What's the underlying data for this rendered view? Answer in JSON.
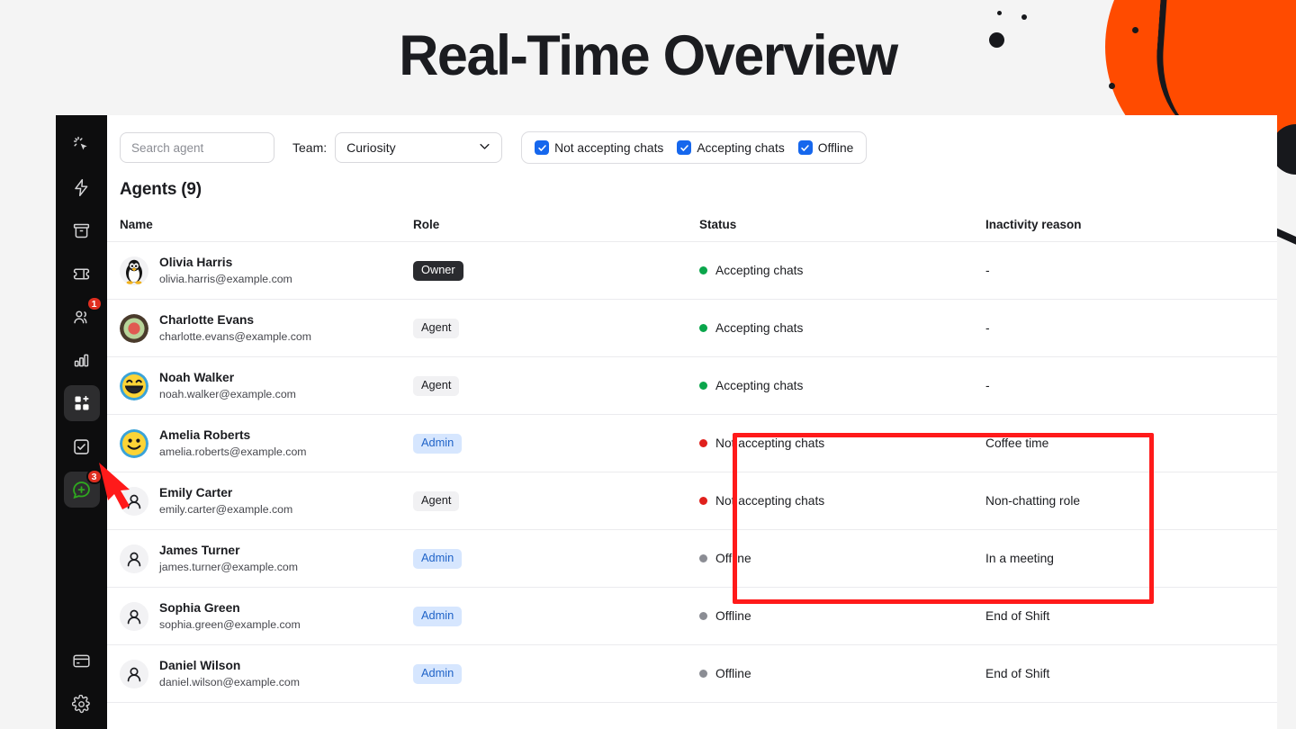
{
  "page": {
    "title": "Real-Time Overview",
    "background_color": "#f4f4f4",
    "accent_orange": "#ff4b00",
    "highlight_color": "#ff1a1a"
  },
  "sidebar": {
    "items": [
      {
        "name": "automation-cursor-icon",
        "icon": "cursor-sparkle",
        "badge": null,
        "active": false
      },
      {
        "name": "quick-actions-icon",
        "icon": "lightning-bolt",
        "badge": null,
        "active": false
      },
      {
        "name": "archives-icon",
        "icon": "archive-box",
        "badge": null,
        "active": false
      },
      {
        "name": "tickets-icon",
        "icon": "ticket",
        "badge": null,
        "active": false
      },
      {
        "name": "team-icon",
        "icon": "people",
        "badge": "1",
        "active": false
      },
      {
        "name": "reports-icon",
        "icon": "bar-chart",
        "badge": null,
        "active": false
      },
      {
        "name": "apps-icon",
        "icon": "grid-plus",
        "badge": null,
        "active": true
      },
      {
        "name": "tasks-icon",
        "icon": "checkbox-task",
        "badge": null,
        "active": false
      },
      {
        "name": "chats-icon",
        "icon": "chat-plus",
        "badge": "3",
        "active": true
      }
    ],
    "bottom_items": [
      {
        "name": "billing-icon",
        "icon": "credit-card"
      },
      {
        "name": "settings-icon",
        "icon": "gear"
      }
    ]
  },
  "toolbar": {
    "search_placeholder": "Search agent",
    "search_value": "",
    "team_label": "Team:",
    "team_selected": "Curiosity",
    "filters": [
      {
        "label": "Not accepting chats",
        "checked": true
      },
      {
        "label": "Accepting chats",
        "checked": true
      },
      {
        "label": "Offline",
        "checked": true
      }
    ]
  },
  "main": {
    "section_title": "Agents (9)",
    "columns": [
      "Name",
      "Role",
      "Status",
      "Inactivity reason"
    ],
    "rows": [
      {
        "name": "Olivia Harris",
        "email": "olivia.harris@example.com",
        "avatar": "penguin",
        "role": "Owner",
        "role_style": "owner",
        "status": "Accepting chats",
        "status_color": "#0aa64b",
        "reason": "-"
      },
      {
        "name": "Charlotte Evans",
        "email": "charlotte.evans@example.com",
        "avatar": "bullseye",
        "role": "Agent",
        "role_style": "agent",
        "status": "Accepting chats",
        "status_color": "#0aa64b",
        "reason": "-"
      },
      {
        "name": "Noah Walker",
        "email": "noah.walker@example.com",
        "avatar": "grin-face",
        "role": "Agent",
        "role_style": "agent",
        "status": "Accepting chats",
        "status_color": "#0aa64b",
        "reason": "-"
      },
      {
        "name": "Amelia Roberts",
        "email": "amelia.roberts@example.com",
        "avatar": "smiley-face",
        "role": "Admin",
        "role_style": "admin",
        "status": "Not accepting chats",
        "status_color": "#e0201c",
        "reason": "Coffee time"
      },
      {
        "name": "Emily Carter",
        "email": "emily.carter@example.com",
        "avatar": "person",
        "role": "Agent",
        "role_style": "agent",
        "status": "Not accepting chats",
        "status_color": "#e0201c",
        "reason": "Non-chatting role"
      },
      {
        "name": "James Turner",
        "email": "james.turner@example.com",
        "avatar": "person",
        "role": "Admin",
        "role_style": "admin",
        "status": "Offline",
        "status_color": "#8b8d94",
        "reason": "In a meeting"
      },
      {
        "name": "Sophia Green",
        "email": "sophia.green@example.com",
        "avatar": "person",
        "role": "Admin",
        "role_style": "admin",
        "status": "Offline",
        "status_color": "#8b8d94",
        "reason": "End of Shift"
      },
      {
        "name": "Daniel Wilson",
        "email": "daniel.wilson@example.com",
        "avatar": "person",
        "role": "Admin",
        "role_style": "admin",
        "status": "Offline",
        "status_color": "#8b8d94",
        "reason": "End of Shift"
      }
    ]
  },
  "annotations": {
    "highlight_rect_label": "status-and-reason-highlight",
    "arrow_label": "pointer-arrow-to-chats-icon"
  }
}
